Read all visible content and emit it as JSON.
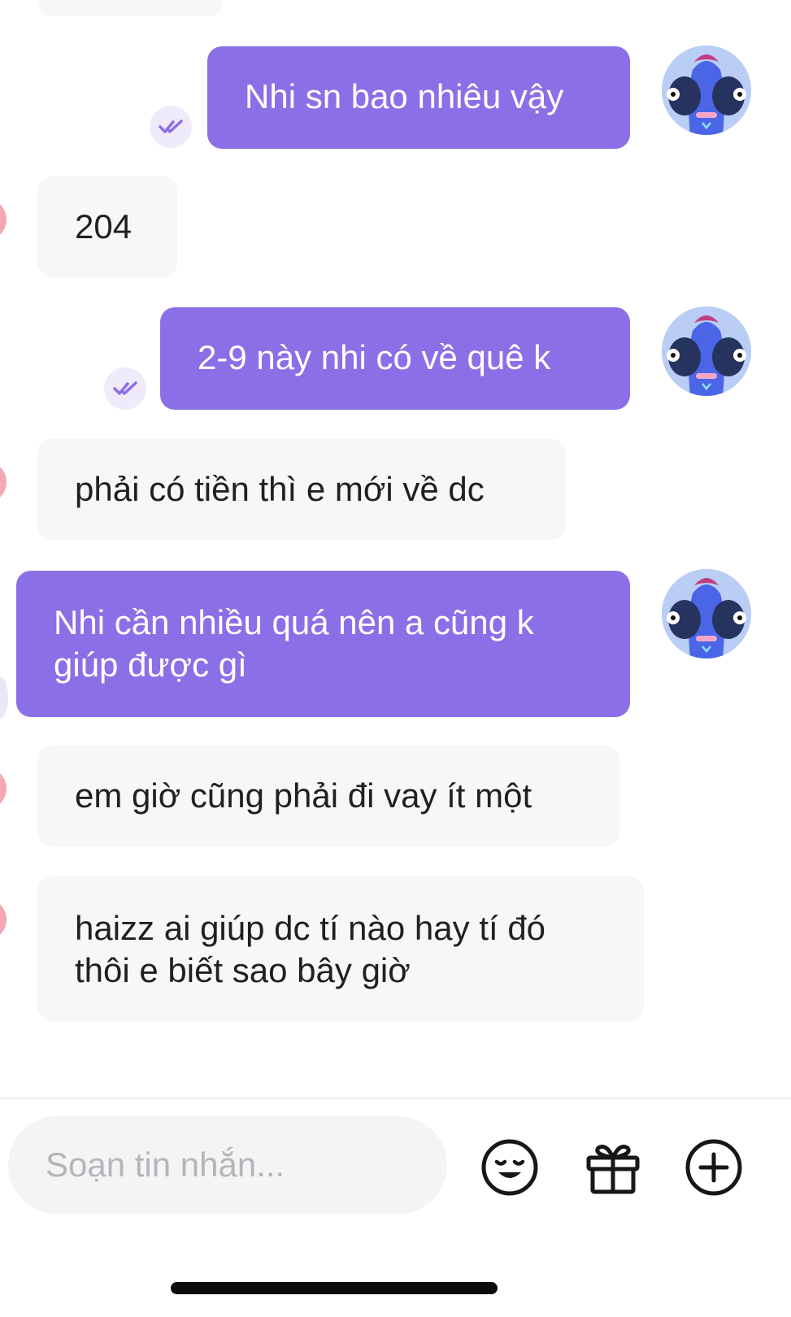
{
  "conversation": {
    "messages": [
      {
        "side": "out",
        "text": "Nhi sn bao nhiêu vậy",
        "read": true
      },
      {
        "side": "in",
        "text": "204"
      },
      {
        "side": "out",
        "text": "2-9 này nhi có về quê k",
        "read": true
      },
      {
        "side": "in",
        "text": "phải có tiền thì e mới về dc"
      },
      {
        "side": "out",
        "text": "Nhi cần nhiều quá nên a cũng k\ngiúp được gì",
        "read": false
      },
      {
        "side": "in",
        "text": "em giờ cũng phải đi vay ít một"
      },
      {
        "side": "in",
        "text": "haizz ai giúp dc tí nào hay tí đó\nthôi e biết sao bây giờ"
      }
    ]
  },
  "composer": {
    "placeholder": "Soạn tin nhắn...",
    "value": "",
    "icons": [
      "smile-emoji-icon",
      "gift-icon",
      "plus-circle-icon"
    ]
  },
  "colors": {
    "outgoing_bubble": "#8b6fe6",
    "incoming_bubble": "#f7f7f8",
    "read_tick": "#8b6fe6",
    "avatar_bg": "#b9cdf5"
  }
}
